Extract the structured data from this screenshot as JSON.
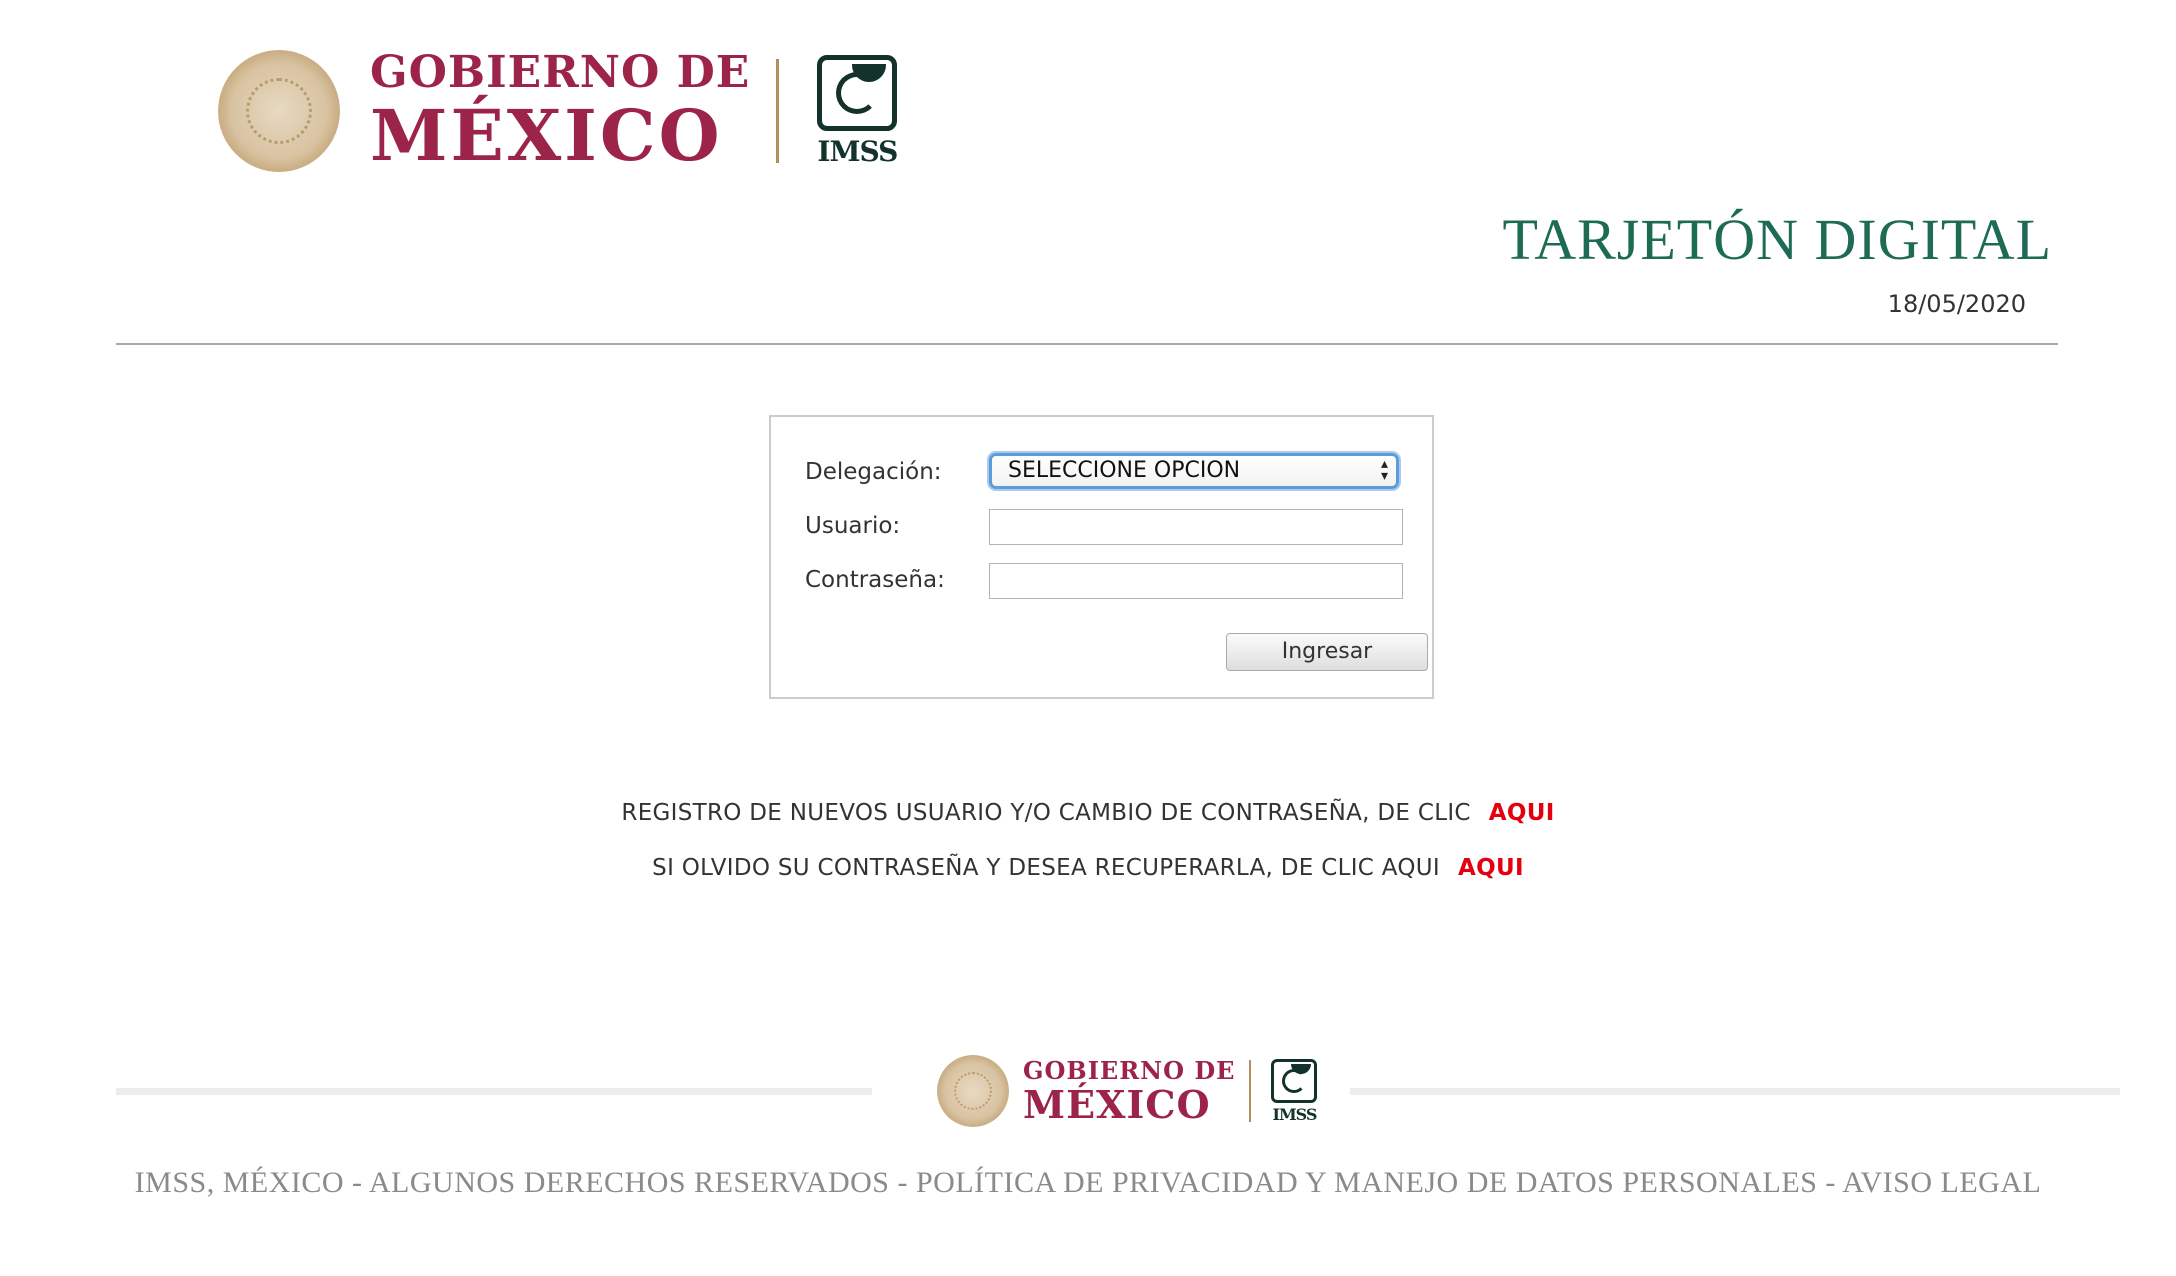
{
  "header": {
    "gobierno_line1": "GOBIERNO DE",
    "gobierno_line2": "MÉXICO",
    "imss_label": "IMSS"
  },
  "page": {
    "title": "TARJETÓN DIGITAL",
    "date": "18/05/2020"
  },
  "login": {
    "delegacion_label": "Delegación:",
    "delegacion_selected": "SELECCIONE OPCION",
    "usuario_label": "Usuario:",
    "usuario_value": "",
    "contrasena_label": "Contraseña:",
    "contrasena_value": "",
    "submit_label": "Ingresar"
  },
  "links": {
    "register_text": "REGISTRO DE NUEVOS USUARIO Y/O CAMBIO DE CONTRASEÑA, DE CLIC",
    "register_link": "AQUI",
    "recover_text": "SI OLVIDO SU CONTRASEÑA Y DESEA RECUPERARLA, DE CLIC AQUI",
    "recover_link": "AQUI"
  },
  "footer": {
    "gobierno_line1": "GOBIERNO DE",
    "gobierno_line2": "MÉXICO",
    "imss_label": "IMSS",
    "legal_text": "IMSS, MÉXICO - ALGUNOS DERECHOS RESERVADOS - POLÍTICA DE PRIVACIDAD Y MANEJO DE DATOS PERSONALES - AVISO LEGAL"
  },
  "colors": {
    "gobierno_red": "#9d2449",
    "gold": "#b38e5d",
    "imss_green": "#13322b",
    "title_green": "#1e6b55",
    "link_red": "#e3000f"
  },
  "icons": {
    "seal": "national-seal-icon",
    "imss": "imss-logo-icon",
    "select_arrows": "select-arrows-icon"
  }
}
